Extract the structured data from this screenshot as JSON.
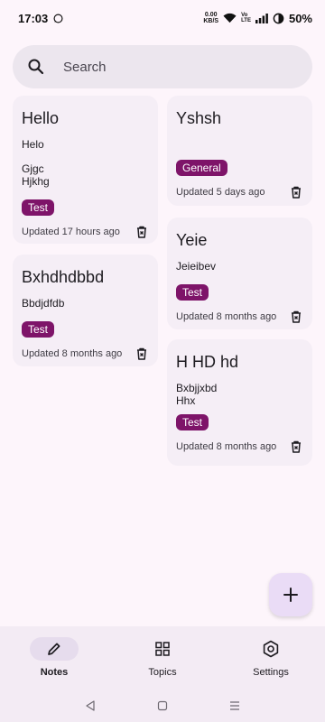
{
  "status_bar": {
    "time": "17:03",
    "net_speed_value": "0.00",
    "net_speed_unit": "KB/S",
    "volte_top": "Vo",
    "volte_bottom": "LTE",
    "battery": "50%"
  },
  "search": {
    "placeholder": "Search"
  },
  "notes": [
    {
      "title": "Hello",
      "body": "Helo",
      "extra": "Gjgc\nHjkhg",
      "tag": "Test",
      "updated": "Updated 17 hours ago"
    },
    {
      "title": "Bxhdhdbbd",
      "body": "Bbdjdfdb",
      "tag": "Test",
      "updated": "Updated 8 months ago"
    },
    {
      "title": "Yshsh",
      "tag": "General",
      "updated": "Updated 5 days ago"
    },
    {
      "title": "Yeie",
      "body": "Jeieibev",
      "tag": "Test",
      "updated": "Updated 8 months ago"
    },
    {
      "title": "H HD hd",
      "body": "Bxbjjxbd\nHhx",
      "tag": "Test",
      "updated": "Updated 8 months ago"
    }
  ],
  "bottom_nav": {
    "items": [
      {
        "label": "Notes",
        "icon": "pencil-icon",
        "active": true
      },
      {
        "label": "Topics",
        "icon": "grid-icon",
        "active": false
      },
      {
        "label": "Settings",
        "icon": "hexagon-gear-icon",
        "active": false
      }
    ]
  },
  "colors": {
    "background": "#fdf5fb",
    "card": "#f5eef6",
    "tag": "#7e1469",
    "fab": "#eadcf6"
  }
}
